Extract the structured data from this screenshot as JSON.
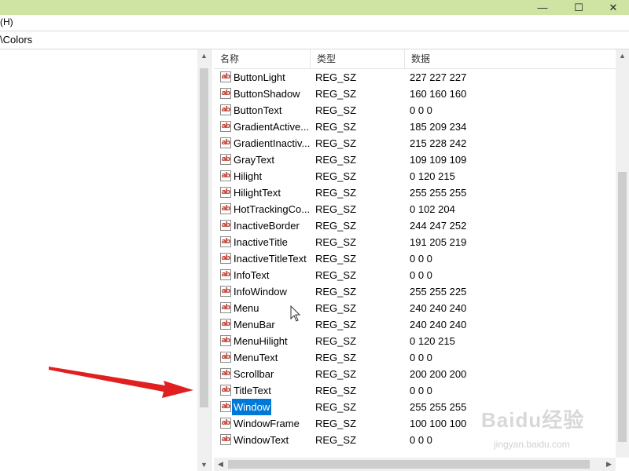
{
  "menu": {
    "text": "(H)"
  },
  "address": {
    "path": "\\Colors"
  },
  "window_controls": {
    "minimize": "—",
    "maximize": "☐",
    "close": "✕"
  },
  "columns": {
    "name": "名称",
    "type": "类型",
    "data": "数据"
  },
  "rows": [
    {
      "name": "ButtonLight",
      "type": "REG_SZ",
      "data": "227 227 227"
    },
    {
      "name": "ButtonShadow",
      "type": "REG_SZ",
      "data": "160 160 160"
    },
    {
      "name": "ButtonText",
      "type": "REG_SZ",
      "data": "0 0 0"
    },
    {
      "name": "GradientActive...",
      "type": "REG_SZ",
      "data": "185 209 234"
    },
    {
      "name": "GradientInactiv...",
      "type": "REG_SZ",
      "data": "215 228 242"
    },
    {
      "name": "GrayText",
      "type": "REG_SZ",
      "data": "109 109 109"
    },
    {
      "name": "Hilight",
      "type": "REG_SZ",
      "data": "0 120 215"
    },
    {
      "name": "HilightText",
      "type": "REG_SZ",
      "data": "255 255 255"
    },
    {
      "name": "HotTrackingCo...",
      "type": "REG_SZ",
      "data": "0 102 204"
    },
    {
      "name": "InactiveBorder",
      "type": "REG_SZ",
      "data": "244 247 252"
    },
    {
      "name": "InactiveTitle",
      "type": "REG_SZ",
      "data": "191 205 219"
    },
    {
      "name": "InactiveTitleText",
      "type": "REG_SZ",
      "data": "0 0 0"
    },
    {
      "name": "InfoText",
      "type": "REG_SZ",
      "data": "0 0 0"
    },
    {
      "name": "InfoWindow",
      "type": "REG_SZ",
      "data": "255 255 225"
    },
    {
      "name": "Menu",
      "type": "REG_SZ",
      "data": "240 240 240"
    },
    {
      "name": "MenuBar",
      "type": "REG_SZ",
      "data": "240 240 240"
    },
    {
      "name": "MenuHilight",
      "type": "REG_SZ",
      "data": "0 120 215"
    },
    {
      "name": "MenuText",
      "type": "REG_SZ",
      "data": "0 0 0"
    },
    {
      "name": "Scrollbar",
      "type": "REG_SZ",
      "data": "200 200 200"
    },
    {
      "name": "TitleText",
      "type": "REG_SZ",
      "data": "0 0 0"
    },
    {
      "name": "Window",
      "type": "REG_SZ",
      "data": "255 255 255",
      "selected": true
    },
    {
      "name": "WindowFrame",
      "type": "REG_SZ",
      "data": "100 100 100"
    },
    {
      "name": "WindowText",
      "type": "REG_SZ",
      "data": "0 0 0"
    }
  ],
  "value_icon": "ab",
  "watermark": {
    "brand": "Baidu经验",
    "sub": "jingyan.baidu.com"
  },
  "colors": {
    "titlebar": "#cfe3a3",
    "selection": "#0078d7",
    "annotation_arrow": "#e02020"
  },
  "icons": [
    "minimize-icon",
    "maximize-icon",
    "close-icon",
    "reg-string-icon",
    "scroll-up-icon",
    "scroll-down-icon",
    "scroll-left-icon",
    "scroll-right-icon",
    "mouse-cursor-icon",
    "red-arrow-annotation"
  ]
}
